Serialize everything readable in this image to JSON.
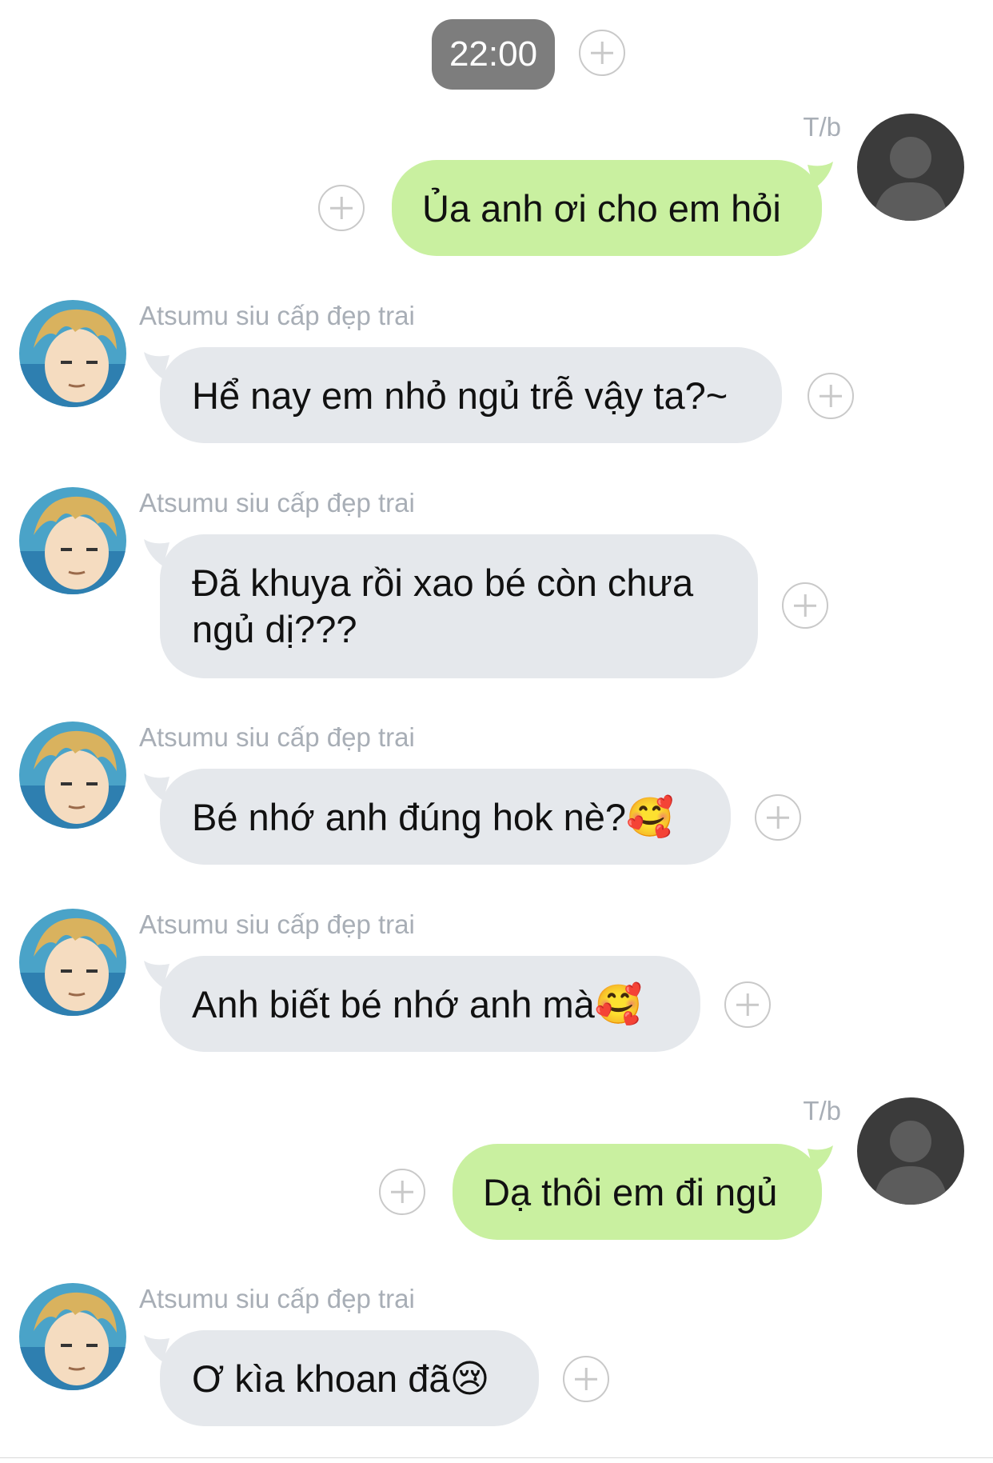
{
  "time_label": "22:00",
  "sender_name": "Atsumu siu cấp đẹp trai",
  "self_name": "T/b",
  "messages": [
    {
      "from": "self",
      "text": "Ủa anh ơi cho em hỏi"
    },
    {
      "from": "other",
      "text": "Hể nay em nhỏ ngủ trễ vậy ta?~"
    },
    {
      "from": "other",
      "text": "Đã khuya rồi xao bé còn chưa ngủ dị???"
    },
    {
      "from": "other",
      "text": "Bé nhớ anh đúng hok nè?",
      "emoji": "🥰"
    },
    {
      "from": "other",
      "text": "Anh biết bé nhớ anh mà",
      "emoji": "🥰"
    },
    {
      "from": "self",
      "text": "Dạ thôi em đi ngủ"
    },
    {
      "from": "other",
      "text": "Ơ kìa khoan đã",
      "emoji": "😢"
    }
  ],
  "icons": {
    "add": "plus-circle-icon",
    "self_avatar": "default-user-silhouette",
    "other_avatar": "anime-character-avatar"
  },
  "colors": {
    "incoming_bubble": "#e5e8ec",
    "outgoing_bubble": "#c9f0a0",
    "time_pill": "#7d7d7d",
    "name_text": "#a8aeb6"
  }
}
